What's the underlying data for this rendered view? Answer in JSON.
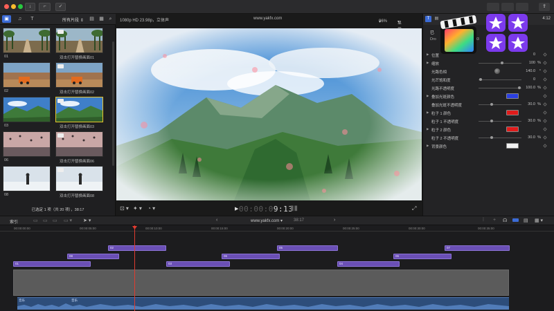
{
  "titlebar": {
    "icons": [
      "download-icon",
      "key-icon",
      "check-icon"
    ]
  },
  "browser": {
    "filter_label": "所有片段",
    "status": "已选定 1 项（共 20 项），38:17",
    "clips": [
      {
        "left": "01",
        "right": "双击打开替换画面01"
      },
      {
        "left": "02",
        "right": "双击打开替换画面02"
      },
      {
        "left": "03",
        "right": "双击打开替换画面03"
      },
      {
        "left": "06",
        "right": "双击打开替换画面06"
      },
      {
        "left": "08",
        "right": "双击打开替换画面08"
      }
    ]
  },
  "viewer": {
    "format": "1080p HD 23.98p，立体声",
    "project_url": "www.yakfx.com",
    "zoom": "96%",
    "display_label": "显示",
    "timecode_dim": "00:00:0",
    "timecode_bright": "9:13"
  },
  "inspector": {
    "title": "已",
    "subtitle": "Dro",
    "subtitle_suffix": "03",
    "duration": "4:12",
    "properties": [
      {
        "name": "位置",
        "value": "0",
        "unit": "",
        "arrow": true,
        "type": "text"
      },
      {
        "name": "缩放",
        "value": "100",
        "unit": "%",
        "arrow": true,
        "type": "slider",
        "level": 0.55
      },
      {
        "name": "光路色相",
        "value": "140.0",
        "unit": "°",
        "arrow": false,
        "type": "dial"
      },
      {
        "name": "光芒饱和度",
        "value": "0",
        "unit": "",
        "arrow": false,
        "type": "slider",
        "level": 0.02
      },
      {
        "name": "光路不透明度",
        "value": "100.0",
        "unit": "%",
        "arrow": false,
        "type": "slider",
        "level": 0.98
      },
      {
        "name": "叠加光斑颜色",
        "value": "",
        "unit": "",
        "arrow": true,
        "type": "swatch",
        "color": "#2b3fe0"
      },
      {
        "name": "叠加光斑不透明度",
        "value": "30.0",
        "unit": "%",
        "arrow": false,
        "type": "slider",
        "level": 0.3
      },
      {
        "name": "粒子 1 颜色",
        "value": "",
        "unit": "",
        "arrow": true,
        "type": "swatch",
        "color": "#e01b1b"
      },
      {
        "name": "粒子 1 不透明度",
        "value": "30.0",
        "unit": "%",
        "arrow": false,
        "type": "slider",
        "level": 0.3
      },
      {
        "name": "粒子 2 颜色",
        "value": "",
        "unit": "",
        "arrow": true,
        "type": "swatch",
        "color": "#e01b1b"
      },
      {
        "name": "粒子 2 不透明度",
        "value": "30.0",
        "unit": "%",
        "arrow": false,
        "type": "slider",
        "level": 0.3
      },
      {
        "name": "背景颜色",
        "value": "",
        "unit": "",
        "arrow": true,
        "type": "swatch",
        "color": "#f2f2f2"
      }
    ]
  },
  "timeline": {
    "index_label": "索引",
    "project_url": "www.yakfx.com",
    "duration": "38:17",
    "ruler": [
      "00:00:00:00",
      "00:00:05:00",
      "00:00:10:00",
      "00:00:15:00",
      "00:00:20:00",
      "00:00:25:00",
      "00:00:30:00",
      "00:00:35:00"
    ],
    "audio_label": "音乐",
    "audio_label_2": "音乐"
  },
  "colors": {
    "accent": "#6a4fb5",
    "playhead": "#e03b2f",
    "audio": "#2d4d7a"
  }
}
